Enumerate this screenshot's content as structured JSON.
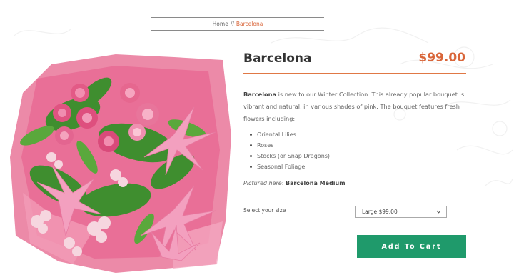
{
  "breadcrumb": {
    "home": "Home",
    "separator": "//",
    "current": "Barcelona"
  },
  "product": {
    "title": "Barcelona",
    "price": "$99.00",
    "description_lead": "Barcelona",
    "description_rest": " is new to our Winter Collection. This already popular bouquet is vibrant and natural, in various shades of pink. The bouquet features fresh flowers including:",
    "features": [
      "Oriental Lilies",
      "Roses",
      "Stocks (or Snap Dragons)",
      "Seasonal Foliage"
    ],
    "pictured_label": "Pictured here",
    "pictured_value": "Barcelona Medium",
    "size_label": "Select your size",
    "size_selected": "Large $99.00",
    "add_to_cart": "Add To Cart",
    "image_alt": "bouquet-photo"
  },
  "colors": {
    "accent": "#d9663a",
    "button": "#1f9a6b",
    "wrap_pink": "#e8739a"
  }
}
